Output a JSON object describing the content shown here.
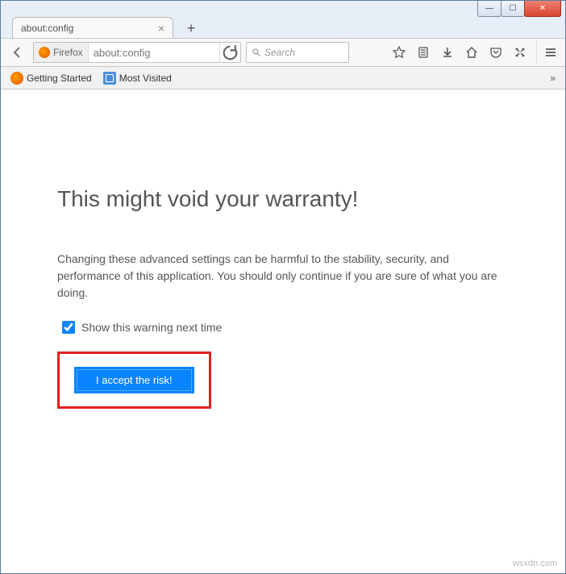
{
  "window": {
    "minimize_symbol": "—",
    "maximize_symbol": "☐",
    "close_symbol": "✕"
  },
  "tabs": {
    "active_label": "about:config",
    "close_symbol": "×",
    "new_tab_symbol": "+"
  },
  "nav": {
    "identity_label": "Firefox",
    "url_value": "about:config"
  },
  "search": {
    "placeholder": "Search"
  },
  "bookmarks": {
    "items": [
      {
        "label": "Getting Started"
      },
      {
        "label": "Most Visited"
      }
    ],
    "overflow_symbol": "»"
  },
  "warning": {
    "title": "This might void your warranty!",
    "description": "Changing these advanced settings can be harmful to the stability, security, and performance of this application. You should only continue if you are sure of what you are doing.",
    "checkbox_label": "Show this warning next time",
    "checkbox_checked": true,
    "accept_button": "I accept the risk!"
  },
  "watermark": "wsxdn.com"
}
